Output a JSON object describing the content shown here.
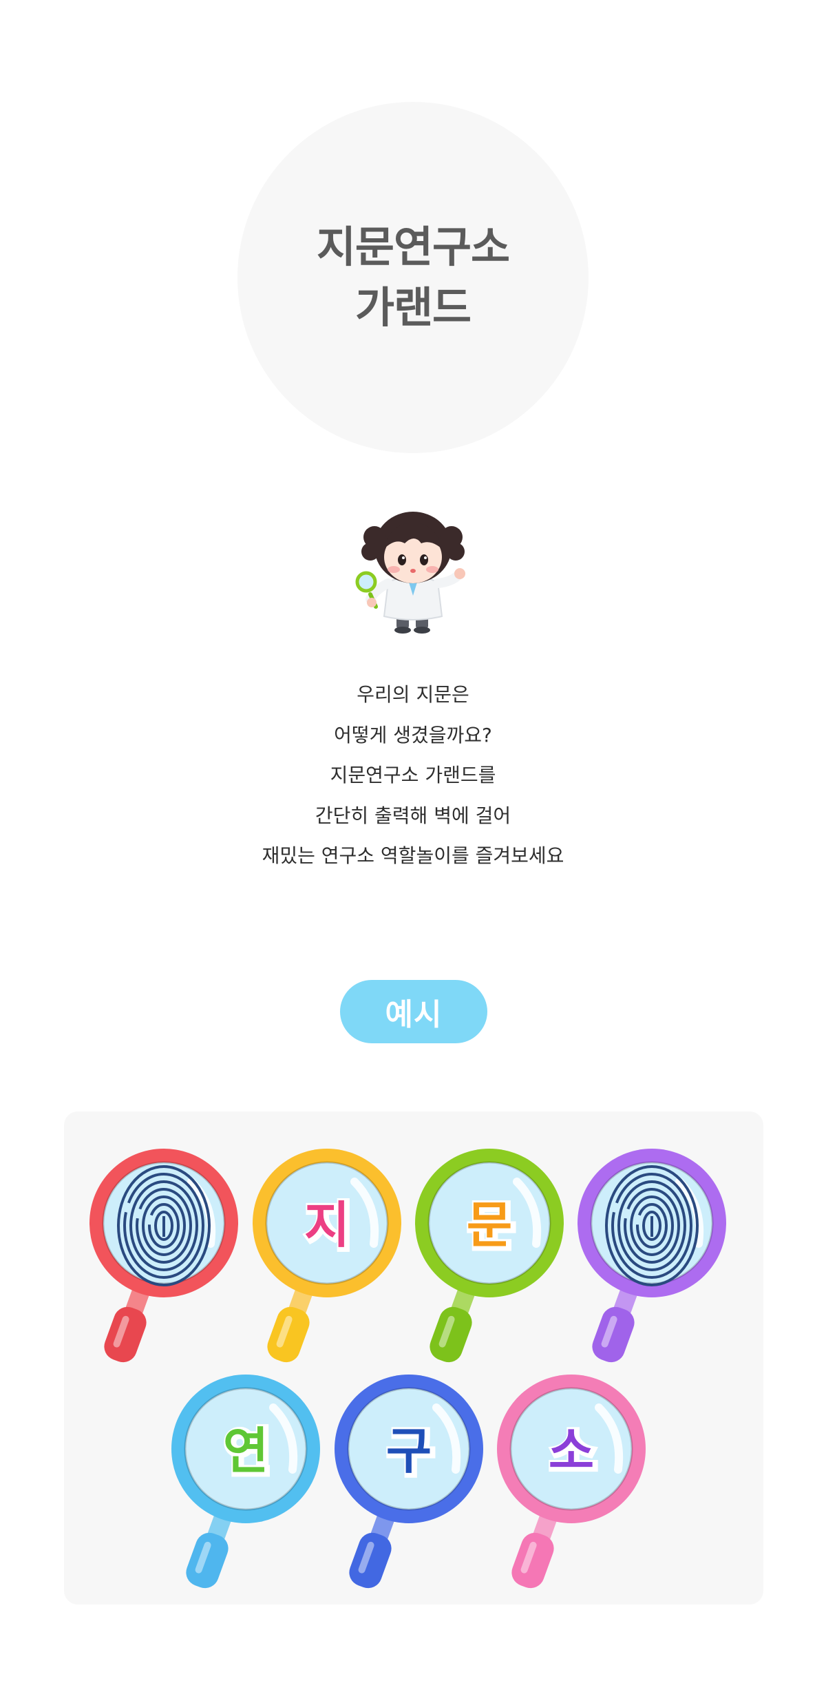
{
  "hero": {
    "title_line1": "지문연구소",
    "title_line2": "가랜드"
  },
  "intro": {
    "lines": [
      "우리의 지문은",
      "어떻게 생겼을까요?",
      "지문연구소 가랜드를",
      "간단히 출력해 벽에 걸어",
      "재밌는 연구소 역할놀이를 즐겨보세요"
    ]
  },
  "example": {
    "badge_label": "예시"
  },
  "garland": {
    "items": [
      {
        "type": "fingerprint",
        "text": "",
        "ring_color": "#f2545b",
        "handle_color": "#e8474f",
        "name": "fingerprint"
      },
      {
        "type": "letter",
        "text": "지",
        "ring_color": "#fbbf2d",
        "handle_color": "#f9c521",
        "letter_color": "#ec3f83",
        "name": "ji"
      },
      {
        "type": "letter",
        "text": "문",
        "ring_color": "#8ccc22",
        "handle_color": "#7dc21b",
        "letter_color": "#f79b18",
        "name": "mun"
      },
      {
        "type": "fingerprint",
        "text": "",
        "ring_color": "#ad6cf0",
        "handle_color": "#a063ea",
        "name": "fingerprint"
      },
      {
        "type": "letter",
        "text": "연",
        "ring_color": "#52bff0",
        "handle_color": "#4fb6ee",
        "letter_color": "#5fc735",
        "name": "yeon"
      },
      {
        "type": "letter",
        "text": "구",
        "ring_color": "#4a6ee8",
        "handle_color": "#4268e2",
        "letter_color": "#1f4fb8",
        "name": "gu"
      },
      {
        "type": "letter",
        "text": "소",
        "ring_color": "#f47db6",
        "handle_color": "#f577b5",
        "letter_color": "#8b3fd8",
        "name": "so"
      }
    ]
  },
  "colors": {
    "title": "#5b5b5b",
    "badge": "#7fd8f7",
    "panel": "#f7f7f7",
    "lens": "#cdeefb"
  }
}
